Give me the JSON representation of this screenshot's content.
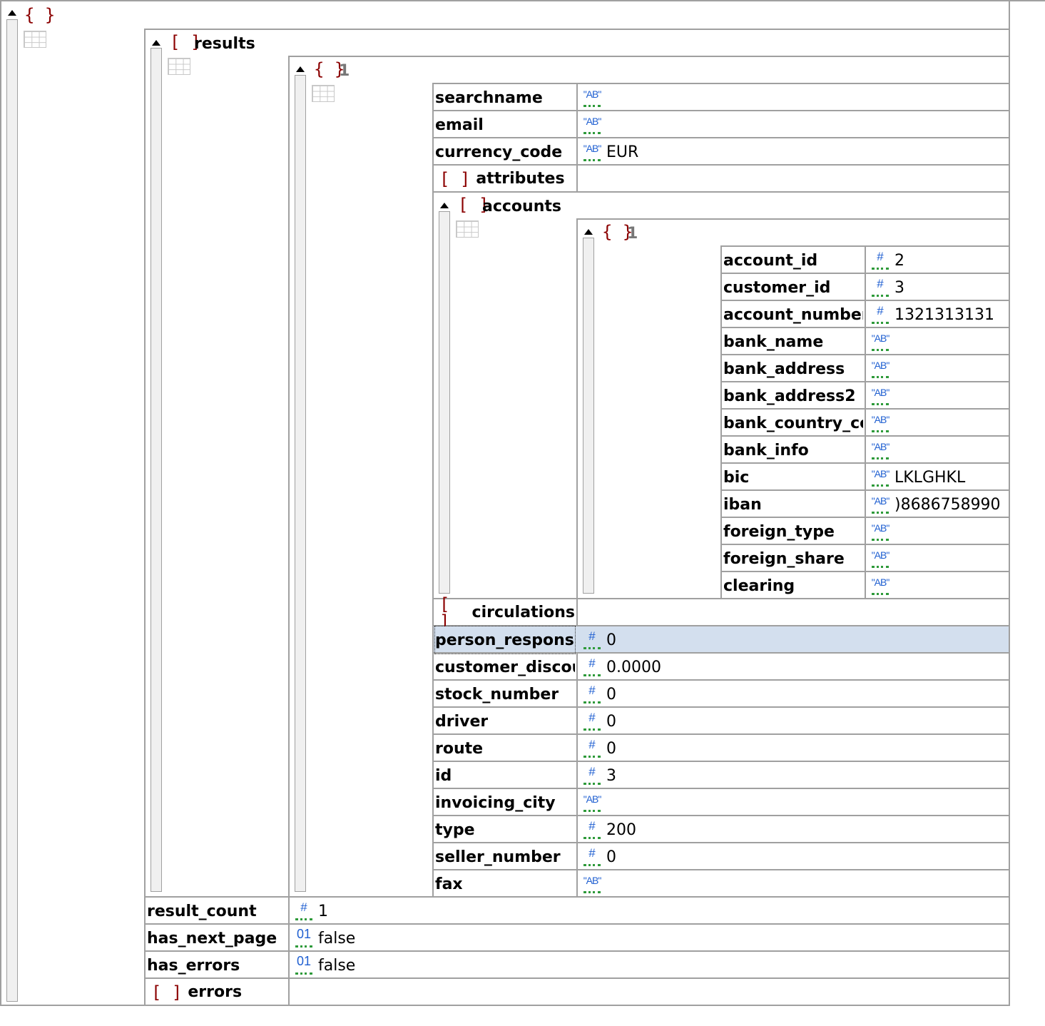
{
  "root": {
    "brackets": "{ }"
  },
  "results": {
    "label": "results",
    "brackets": "[ ]",
    "item": {
      "brackets": "{ }",
      "index": "1",
      "fields_top": [
        {
          "key": "searchname",
          "type": "string",
          "value": ""
        },
        {
          "key": "email",
          "type": "string",
          "value": ""
        },
        {
          "key": "currency_code",
          "type": "string",
          "value": "EUR"
        }
      ],
      "attributes": {
        "label": "attributes",
        "brackets": "[ ]"
      },
      "accounts": {
        "label": "accounts",
        "brackets": "[ ]",
        "item": {
          "brackets": "{ }",
          "index": "1",
          "fields": [
            {
              "key": "account_id",
              "type": "number",
              "value": "2"
            },
            {
              "key": "customer_id",
              "type": "number",
              "value": "3"
            },
            {
              "key": "account_number",
              "type": "number",
              "value": "1321313131"
            },
            {
              "key": "bank_name",
              "type": "string",
              "value": ""
            },
            {
              "key": "bank_address",
              "type": "string",
              "value": ""
            },
            {
              "key": "bank_address2",
              "type": "string",
              "value": ""
            },
            {
              "key": "bank_country_co",
              "type": "string",
              "value": ""
            },
            {
              "key": "bank_info",
              "type": "string",
              "value": ""
            },
            {
              "key": "bic",
              "type": "string",
              "value": "LKLGHKL"
            },
            {
              "key": "iban",
              "type": "string",
              "value": ")8686758990"
            },
            {
              "key": "foreign_type",
              "type": "string",
              "value": ""
            },
            {
              "key": "foreign_share",
              "type": "string",
              "value": ""
            },
            {
              "key": "clearing",
              "type": "string",
              "value": ""
            }
          ]
        }
      },
      "circulations": {
        "label": "circulations",
        "brackets": "[ ]"
      },
      "fields_bottom": [
        {
          "key": "person_responsil",
          "type": "number",
          "value": "0",
          "selected": true
        },
        {
          "key": "customer_discou",
          "type": "number",
          "value": "0.0000"
        },
        {
          "key": "stock_number",
          "type": "number",
          "value": "0"
        },
        {
          "key": "driver",
          "type": "number",
          "value": "0"
        },
        {
          "key": "route",
          "type": "number",
          "value": "0"
        },
        {
          "key": "id",
          "type": "number",
          "value": "3"
        },
        {
          "key": "invoicing_city",
          "type": "string",
          "value": ""
        },
        {
          "key": "type",
          "type": "number",
          "value": "200"
        },
        {
          "key": "seller_number",
          "type": "number",
          "value": "0"
        },
        {
          "key": "fax",
          "type": "string",
          "value": ""
        }
      ]
    }
  },
  "root_fields": [
    {
      "key": "result_count",
      "type": "number",
      "value": "1"
    },
    {
      "key": "has_next_page",
      "type": "boolean",
      "value": "false"
    },
    {
      "key": "has_errors",
      "type": "boolean",
      "value": "false"
    }
  ],
  "errors": {
    "label": "errors",
    "brackets": "[ ]"
  },
  "type_icons": {
    "number": "#",
    "string": "\"AB\"",
    "boolean": "01"
  },
  "colors": {
    "bracket": "#8b0000",
    "type_icon": "#1f5fd1",
    "type_underline": "#2e9a3a",
    "selected_row": "#d3dfee",
    "grid_line": "#a0a0a0"
  }
}
